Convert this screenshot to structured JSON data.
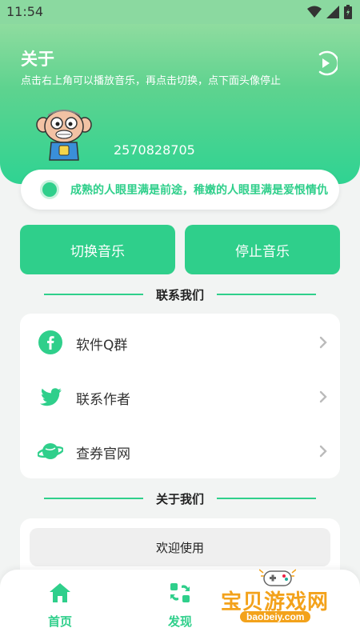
{
  "status_bar": {
    "time": "11:54"
  },
  "header": {
    "title": "关于",
    "subtitle": "点击右上角可以播放音乐，再点击切换，点下面头像停止",
    "qq_number": "2570828705"
  },
  "marquee": {
    "text": "成熟的人眼里满是前途，稚嫩的人眼里满是爱恨情仇"
  },
  "buttons": {
    "switch_music": "切换音乐",
    "stop_music": "停止音乐"
  },
  "contact": {
    "title": "联系我们",
    "items": [
      {
        "label": "软件Q群",
        "icon": "facebook-icon"
      },
      {
        "label": "联系作者",
        "icon": "twitter-icon"
      },
      {
        "label": "查券官网",
        "icon": "planet-icon"
      }
    ]
  },
  "about": {
    "title": "关于我们",
    "welcome": "欢迎使用"
  },
  "tabbar": {
    "home": "首页",
    "discover": "发现"
  },
  "watermark": {
    "title": "宝贝游戏网",
    "url": "baobeiy.com"
  },
  "colors": {
    "accent": "#2fcf8b",
    "header_start": "#8fdc9f",
    "watermark": "#f3a21b"
  }
}
